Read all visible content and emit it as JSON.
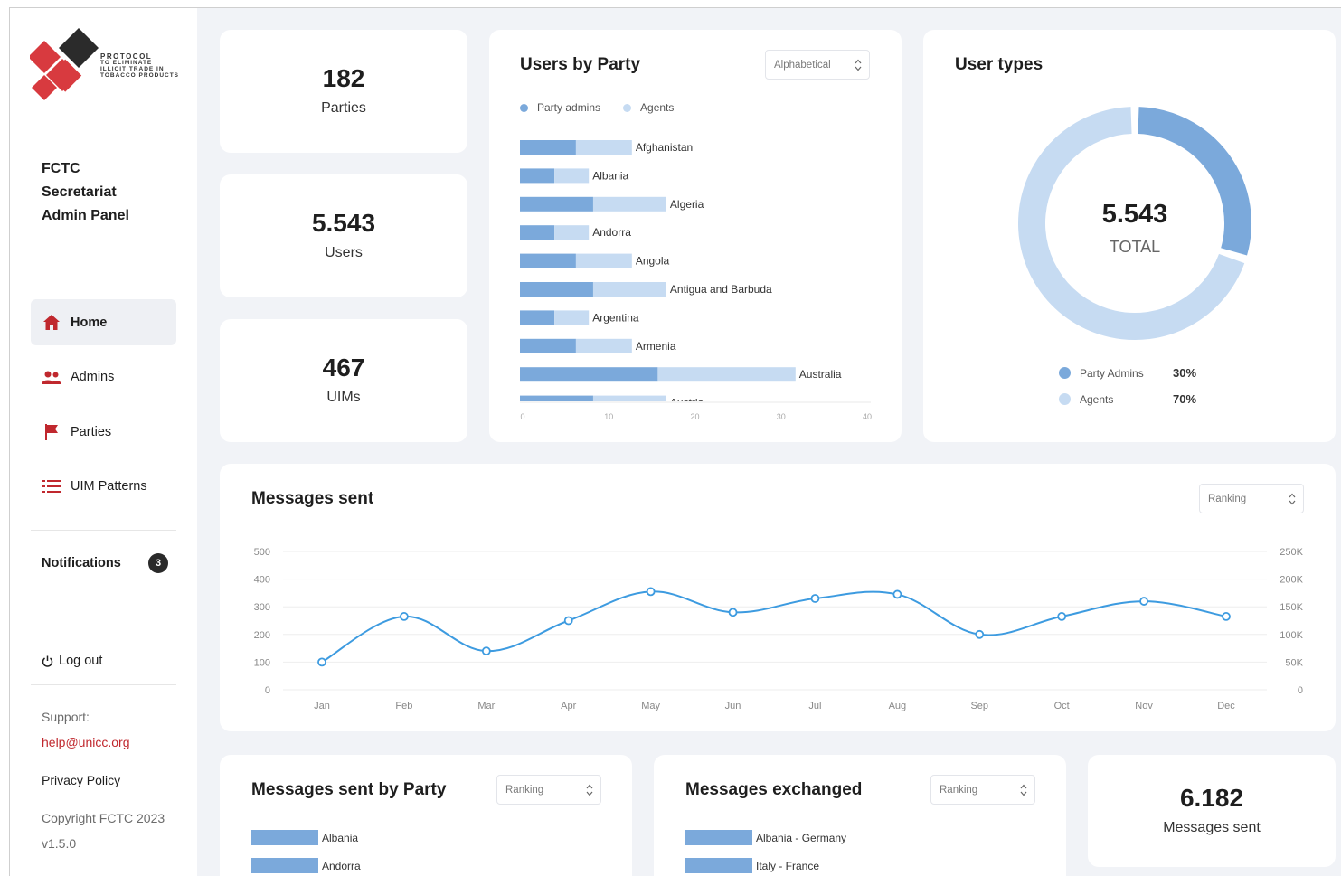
{
  "sidebar": {
    "logo_text": [
      "Protocol",
      "to eliminate",
      "illicit trade in",
      "tobacco products"
    ],
    "app_title": [
      "FCTC",
      "Secretariat",
      "Admin Panel"
    ],
    "nav": [
      {
        "label": "Home",
        "icon": "home-icon",
        "active": true
      },
      {
        "label": "Admins",
        "icon": "users-icon",
        "active": false
      },
      {
        "label": "Parties",
        "icon": "flag-icon",
        "active": false
      },
      {
        "label": "UIM Patterns",
        "icon": "list-icon",
        "active": false
      }
    ],
    "notifications_label": "Notifications",
    "notifications_count": "3",
    "logout_label": "Log out",
    "support_label": "Support:",
    "support_email": "help@unicc.org",
    "privacy_label": "Privacy Policy",
    "copyright": "Copyright FCTC 2023",
    "version": "v1.5.0"
  },
  "stats": [
    {
      "value": "182",
      "label": "Parties"
    },
    {
      "value": "5.543",
      "label": "Users"
    },
    {
      "value": "467",
      "label": "UIMs"
    }
  ],
  "colors": {
    "primary": "#7ba9db",
    "light": "#c6dbf2",
    "line": "#3d9be0",
    "brand_red": "#d83a3f"
  },
  "users_by_party": {
    "title": "Users by Party",
    "select_value": "Alphabetical",
    "legend": [
      "Party admins",
      "Agents"
    ],
    "chart_data": {
      "type": "bar",
      "orientation": "horizontal",
      "stacked": true,
      "categories": [
        "Afghanistan",
        "Albania",
        "Algeria",
        "Andorra",
        "Angola",
        "Antigua and Barbuda",
        "Argentina",
        "Armenia",
        "Australia",
        "Austria"
      ],
      "series": [
        {
          "name": "Party admins",
          "values": [
            6.5,
            4,
            8.5,
            4,
            6.5,
            8.5,
            4,
            6.5,
            16,
            8.5
          ]
        },
        {
          "name": "Agents",
          "values": [
            6.5,
            4,
            8.5,
            4,
            6.5,
            8.5,
            4,
            6.5,
            16,
            8.5
          ]
        }
      ],
      "xlim": [
        0,
        40
      ],
      "xticks": [
        "0",
        "10",
        "20",
        "30",
        "40"
      ]
    }
  },
  "user_types": {
    "title": "User types",
    "total_value": "5.543",
    "total_label": "TOTAL",
    "legend": [
      {
        "label": "Party Admins",
        "percent": "30%"
      },
      {
        "label": "Agents",
        "percent": "70%"
      }
    ],
    "chart_data": {
      "type": "pie",
      "donut": true,
      "labels": [
        "Party Admins",
        "Agents"
      ],
      "values": [
        30,
        70
      ]
    }
  },
  "messages_sent": {
    "title": "Messages sent",
    "select_value": "Ranking",
    "chart_data": {
      "type": "line",
      "x": [
        "Jan",
        "Feb",
        "Mar",
        "Apr",
        "May",
        "Jun",
        "Jul",
        "Aug",
        "Sep",
        "Oct",
        "Nov",
        "Dec"
      ],
      "values": [
        100,
        265,
        140,
        250,
        355,
        280,
        330,
        345,
        200,
        265,
        320,
        265
      ],
      "ylim": [
        0,
        500
      ],
      "yticks": [
        "0",
        "100",
        "200",
        "300",
        "400",
        "500"
      ],
      "y2ticks": [
        "0",
        "50K",
        "100K",
        "150K",
        "200K",
        "250K"
      ]
    }
  },
  "messages_by_party": {
    "title": "Messages sent by Party",
    "select_value": "Ranking",
    "items": [
      "Albania",
      "Andorra"
    ]
  },
  "messages_exchanged": {
    "title": "Messages exchanged",
    "select_value": "Ranking",
    "items": [
      "Albania - Germany",
      "Italy - France"
    ]
  },
  "messages_total": {
    "value": "6.182",
    "label": "Messages sent"
  }
}
